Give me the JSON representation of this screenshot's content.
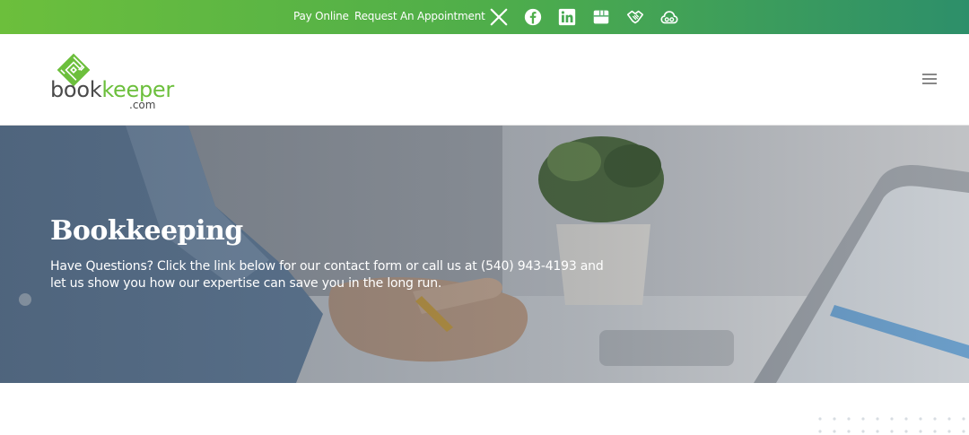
{
  "topbar": {
    "pay_online": "Pay Online",
    "request_appointment": "Request An Appointment",
    "social_icons": [
      "x-icon",
      "facebook-icon",
      "linkedin-icon",
      "google-business-icon",
      "handshake-icon",
      "cloud-icon"
    ]
  },
  "header": {
    "logo_book": "book",
    "logo_keeper": "keeper",
    "logo_dotcom": ".com"
  },
  "hero": {
    "title": "Bookkeeping",
    "text": "Have Questions? Click the link below for our contact form or call us at (540) 943-4193 and let us show you how our expertise can save you in the long run."
  },
  "colors": {
    "brand_green": "#6cbf3c",
    "topbar_end": "#2d8f6a",
    "logo_gray": "#4a4a4a"
  }
}
